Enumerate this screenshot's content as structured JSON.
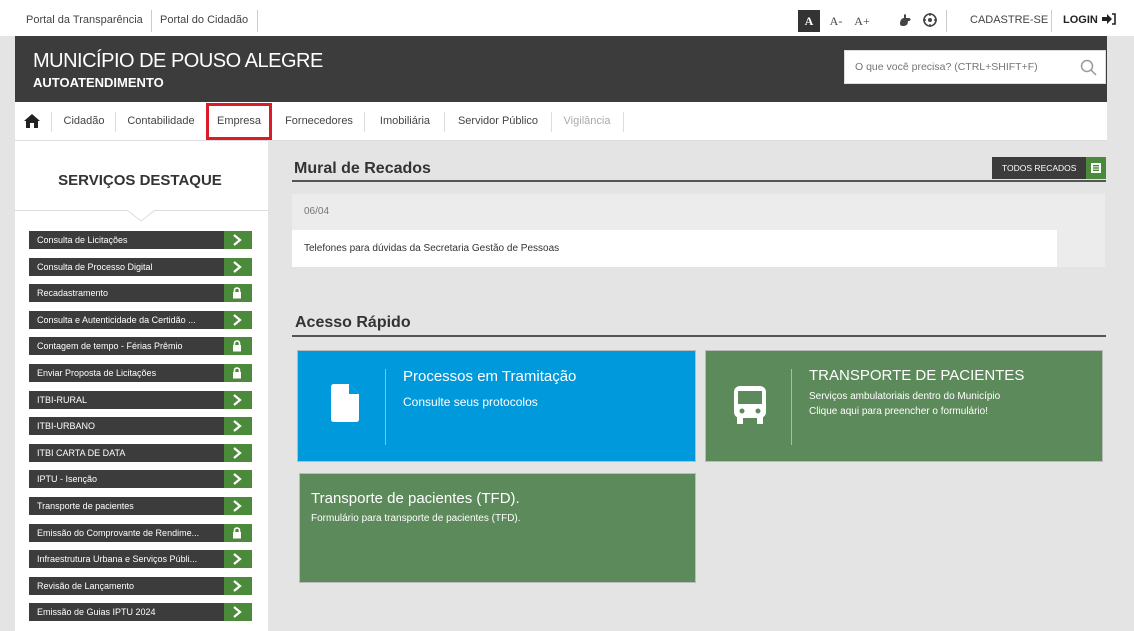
{
  "topbar": {
    "links": [
      "Portal da Transparência",
      "Portal do Cidadão"
    ],
    "font_controls": [
      "A",
      "A-",
      "A+"
    ],
    "register": "CADASTRE-SE",
    "login": "LOGIN"
  },
  "header": {
    "title": "MUNICÍPIO DE POUSO ALEGRE",
    "subtitle": "AUTOATENDIMENTO",
    "search_placeholder": "O que você precisa? (CTRL+SHIFT+F)"
  },
  "nav": {
    "items": [
      "Cidadão",
      "Contabilidade",
      "Empresa",
      "Fornecedores",
      "Imobiliária",
      "Servidor Público",
      "Vigilância"
    ]
  },
  "sidebar": {
    "title": "SERVIÇOS DESTAQUE",
    "items": [
      {
        "label": "Consulta de Licitações",
        "icon": "chevron-right-icon"
      },
      {
        "label": "Consulta de Processo Digital",
        "icon": "chevron-right-icon"
      },
      {
        "label": "Recadastramento",
        "icon": "lock-icon"
      },
      {
        "label": "Consulta e Autenticidade da Certidão ...",
        "icon": "chevron-right-icon"
      },
      {
        "label": "Contagem de tempo - Férias Prêmio",
        "icon": "lock-icon"
      },
      {
        "label": "Enviar Proposta de Licitações",
        "icon": "lock-icon"
      },
      {
        "label": "ITBI-RURAL",
        "icon": "chevron-right-icon"
      },
      {
        "label": "ITBI-URBANO",
        "icon": "chevron-right-icon"
      },
      {
        "label": "ITBI CARTA DE DATA",
        "icon": "chevron-right-icon"
      },
      {
        "label": "IPTU - Isenção",
        "icon": "chevron-right-icon"
      },
      {
        "label": "Transporte de pacientes",
        "icon": "chevron-right-icon"
      },
      {
        "label": "Emissão do Comprovante de Rendime...",
        "icon": "lock-icon"
      },
      {
        "label": "Infraestrutura Urbana e Serviços Públi...",
        "icon": "chevron-right-icon"
      },
      {
        "label": "Revisão de Lançamento",
        "icon": "chevron-right-icon"
      },
      {
        "label": "Emissão de Guias IPTU 2024",
        "icon": "chevron-right-icon"
      }
    ]
  },
  "mural": {
    "title": "Mural de Recados",
    "all_button": "TODOS RECADOS",
    "date": "06/04",
    "message": "Telefones para dúvidas da Secretaria Gestão de Pessoas"
  },
  "quick_access": {
    "title": "Acesso Rápido",
    "cards": [
      {
        "title": "Processos em Tramitação",
        "subtitle": "Consulte seus protocolos",
        "icon": "document-icon",
        "color": "#0099dc"
      },
      {
        "title": "TRANSPORTE DE PACIENTES",
        "subtitle_lines": [
          "Serviços ambulatoriais dentro do Município",
          "Clique aqui para preencher o formulário!"
        ],
        "icon": "bus-icon",
        "color": "#5d8a5a"
      },
      {
        "title": "Transporte de pacientes (TFD).",
        "subtitle": "Formulário para transporte de pacientes (TFD).",
        "color": "#5d8a5a"
      }
    ]
  }
}
